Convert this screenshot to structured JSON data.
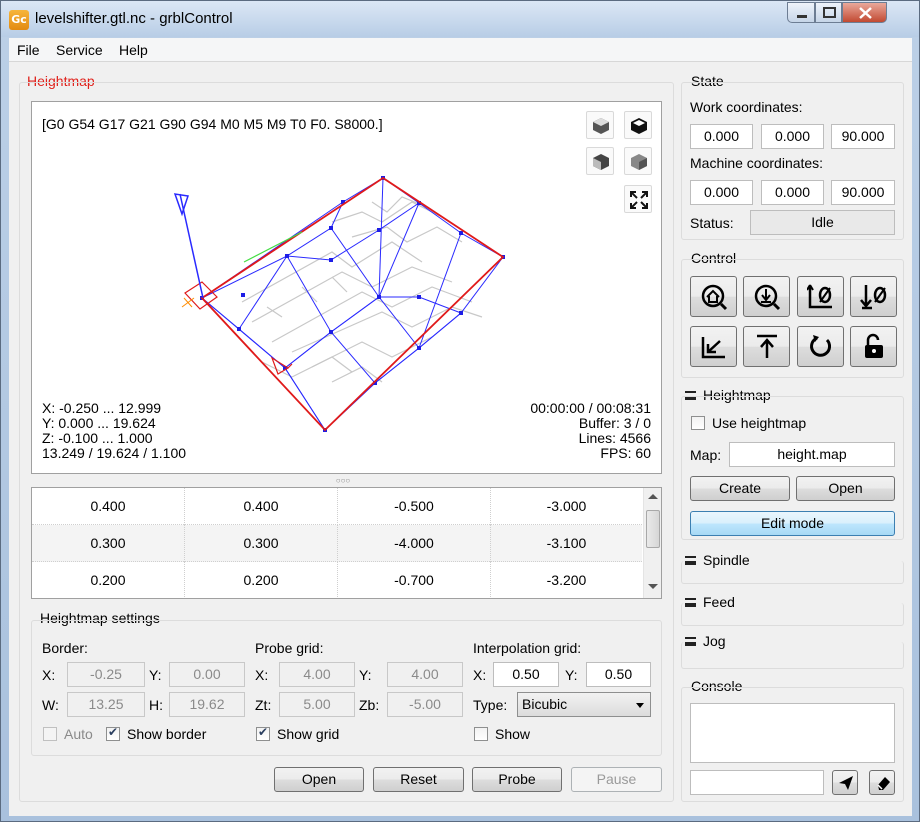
{
  "window": {
    "title": "levelshifter.gtl.nc - grblControl",
    "icon": "gc-app-icon"
  },
  "menu": [
    "File",
    "Service",
    "Help"
  ],
  "heightmap_panel": {
    "title": "Heightmap",
    "gcode_state": "[G0 G54 G17 G21 G90 G94 M0 M5 M9 T0 F0. S8000.]",
    "view_buttons": [
      "iso-view-icon",
      "top-view-icon",
      "left-view-icon",
      "front-view-icon",
      "fit-view-icon"
    ],
    "overlay_left": [
      "X: -0.250 ... 12.999",
      "Y: 0.000 ... 19.624",
      "Z: -0.100 ... 1.000",
      "13.249 / 19.624 / 1.100"
    ],
    "overlay_right": [
      "00:00:00 / 00:08:31",
      "Buffer: 3 / 0",
      "Lines: 4566",
      "FPS: 60"
    ]
  },
  "table_rows": [
    [
      "0.400",
      "0.400",
      "-0.500",
      "-3.000"
    ],
    [
      "0.300",
      "0.300",
      "-4.000",
      "-3.100"
    ],
    [
      "0.200",
      "0.200",
      "-0.700",
      "-3.200"
    ]
  ],
  "settings": {
    "title": "Heightmap settings",
    "border": {
      "label": "Border:",
      "x_label": "X:",
      "x": "-0.25",
      "y_label": "Y:",
      "y": "0.00",
      "w_label": "W:",
      "w": "13.25",
      "h_label": "H:",
      "h": "19.62",
      "auto_label": "Auto",
      "auto_checked": false,
      "show_border_label": "Show border",
      "show_border_checked": true
    },
    "probe": {
      "label": "Probe grid:",
      "x_label": "X:",
      "x": "4.00",
      "y_label": "Y:",
      "y": "4.00",
      "zt_label": "Zt:",
      "zt": "5.00",
      "zb_label": "Zb:",
      "zb": "-5.00",
      "show_grid_label": "Show grid",
      "show_grid_checked": true
    },
    "interp": {
      "label": "Interpolation grid:",
      "x_label": "X:",
      "x": "0.50",
      "y_label": "Y:",
      "y": "0.50",
      "type_label": "Type:",
      "type": "Bicubic",
      "show_label": "Show",
      "show_checked": false
    }
  },
  "bottom_buttons": {
    "open": "Open",
    "reset": "Reset",
    "probe": "Probe",
    "pause": "Pause"
  },
  "state": {
    "title": "State",
    "work_label": "Work coordinates:",
    "work": [
      "0.000",
      "0.000",
      "90.000"
    ],
    "machine_label": "Machine coordinates:",
    "machine": [
      "0.000",
      "0.000",
      "90.000"
    ],
    "status_label": "Status:",
    "status": "Idle"
  },
  "control": {
    "title": "Control",
    "buttons": [
      "home-icon",
      "z-probe-icon",
      "zero-xy-icon",
      "zero-z-icon",
      "restore-origin-icon",
      "safe-position-icon",
      "reset-icon",
      "unlock-icon"
    ]
  },
  "heightmap_side": {
    "title": "Heightmap",
    "use_label": "Use heightmap",
    "use_checked": false,
    "map_label": "Map:",
    "map_value": "height.map",
    "create": "Create",
    "open": "Open",
    "edit": "Edit mode"
  },
  "sections": {
    "spindle": "Spindle",
    "feed": "Feed",
    "jog": "Jog"
  },
  "console": {
    "title": "Console",
    "command": ""
  }
}
